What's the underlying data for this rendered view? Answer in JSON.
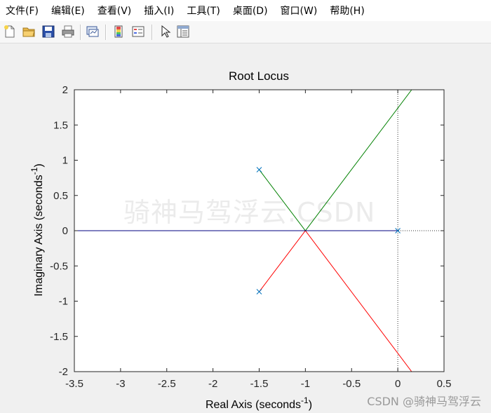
{
  "menubar": {
    "items": [
      "文件(F)",
      "编辑(E)",
      "查看(V)",
      "插入(I)",
      "工具(T)",
      "桌面(D)",
      "窗口(W)",
      "帮助(H)"
    ]
  },
  "toolbar": {
    "buttons": [
      "new-figure-icon",
      "open-file-icon",
      "save-icon",
      "print-icon",
      "link-plot-icon",
      "insert-colorbar-icon",
      "insert-legend-icon",
      "edit-plot-arrow-icon",
      "property-inspector-icon"
    ]
  },
  "colors": {
    "branch_upper": "#008000",
    "branch_lower": "#ff0000",
    "branch_real": "#000080",
    "poles": "#0072bd"
  },
  "chart_data": {
    "type": "line",
    "title": "Root Locus",
    "xlabel": "Real Axis (seconds",
    "xlabel_sup": "-1",
    "xlabel_close": ")",
    "ylabel": "Imaginary Axis (seconds",
    "ylabel_sup": "-1",
    "ylabel_close": ")",
    "xlim": [
      -3.5,
      0.5
    ],
    "ylim": [
      -2,
      2
    ],
    "xticks": [
      -3.5,
      -3,
      -2.5,
      -2,
      -1.5,
      -1,
      -0.5,
      0,
      0.5
    ],
    "xtick_labels": [
      "-3.5",
      "-3",
      "-2.5",
      "-2",
      "-1.5",
      "-1",
      "-0.5",
      "0",
      "0.5"
    ],
    "yticks": [
      2,
      1.5,
      1,
      0.5,
      0,
      -0.5,
      -1,
      -1.5,
      -2
    ],
    "ytick_labels": [
      "2",
      "1.5",
      "1",
      "0.5",
      "0",
      "-0.5",
      "-1",
      "-1.5",
      "-2"
    ],
    "grid": false,
    "series": [
      {
        "color_key": "branch_upper",
        "x": [
          -1.5,
          -1,
          0.15
        ],
        "y": [
          0.866,
          0,
          2
        ]
      },
      {
        "color_key": "branch_lower",
        "x": [
          -1.5,
          -1,
          0.15
        ],
        "y": [
          -0.866,
          0,
          -2
        ]
      },
      {
        "color_key": "branch_real",
        "x": [
          -3.5,
          0
        ],
        "y": [
          0,
          0
        ]
      }
    ],
    "poles": [
      {
        "x": -1.5,
        "y": 0.866
      },
      {
        "x": -1.5,
        "y": -0.866
      },
      {
        "x": 0,
        "y": 0
      }
    ]
  },
  "watermarks": {
    "center": "骑神马驾浮云.CSDN",
    "corner": "CSDN @骑神马驾浮云"
  }
}
